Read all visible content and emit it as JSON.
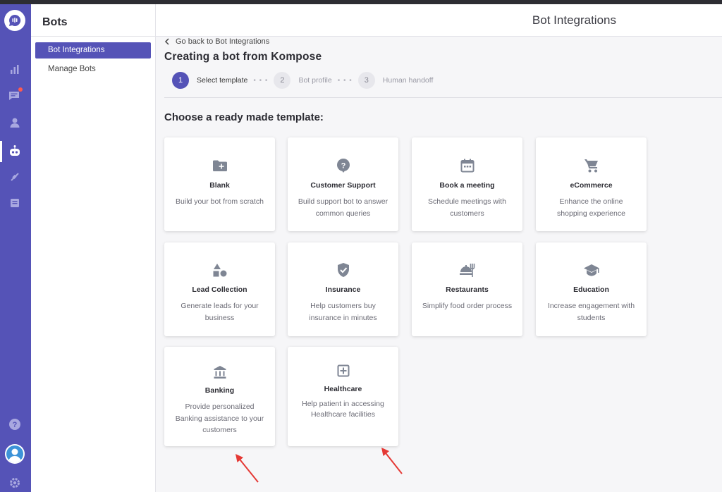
{
  "nav": {
    "section_title": "Bots",
    "items": [
      {
        "label": "Bot Integrations",
        "active": true
      },
      {
        "label": "Manage Bots",
        "active": false
      }
    ]
  },
  "header": {
    "title": "Bot Integrations"
  },
  "back_link": "Go back to Bot Integrations",
  "page_title": "Creating a bot from Kompose",
  "stepper": [
    {
      "number": "1",
      "label": "Select template",
      "active": true
    },
    {
      "number": "2",
      "label": "Bot profile",
      "active": false
    },
    {
      "number": "3",
      "label": "Human handoff",
      "active": false
    }
  ],
  "section_heading": "Choose a ready made template:",
  "templates": [
    {
      "name": "Blank",
      "description": "Build your bot from scratch",
      "icon": "folder-plus-icon"
    },
    {
      "name": "Customer Support",
      "description": "Build support bot to answer common queries",
      "icon": "help-bubble-icon"
    },
    {
      "name": "Book a meeting",
      "description": "Schedule meetings with customers",
      "icon": "calendar-icon"
    },
    {
      "name": "eCommerce",
      "description": "Enhance the online shopping experience",
      "icon": "cart-icon"
    },
    {
      "name": "Lead Collection",
      "description": "Generate leads for your business",
      "icon": "shapes-icon"
    },
    {
      "name": "Insurance",
      "description": "Help customers buy insurance in minutes",
      "icon": "shield-check-icon"
    },
    {
      "name": "Restaurants",
      "description": "Simplify food order process",
      "icon": "food-icon"
    },
    {
      "name": "Education",
      "description": "Increase engagement with students",
      "icon": "graduation-cap-icon"
    },
    {
      "name": "Banking",
      "description": "Provide personalized Banking assistance to your customers",
      "icon": "bank-icon"
    },
    {
      "name": "Healthcare",
      "description": "Help patient in accessing Healthcare facilities",
      "icon": "medical-plus-icon"
    }
  ],
  "colors": {
    "accent": "#5553b7",
    "icon_gray": "#7f8694",
    "annotation_red": "#e53935"
  }
}
